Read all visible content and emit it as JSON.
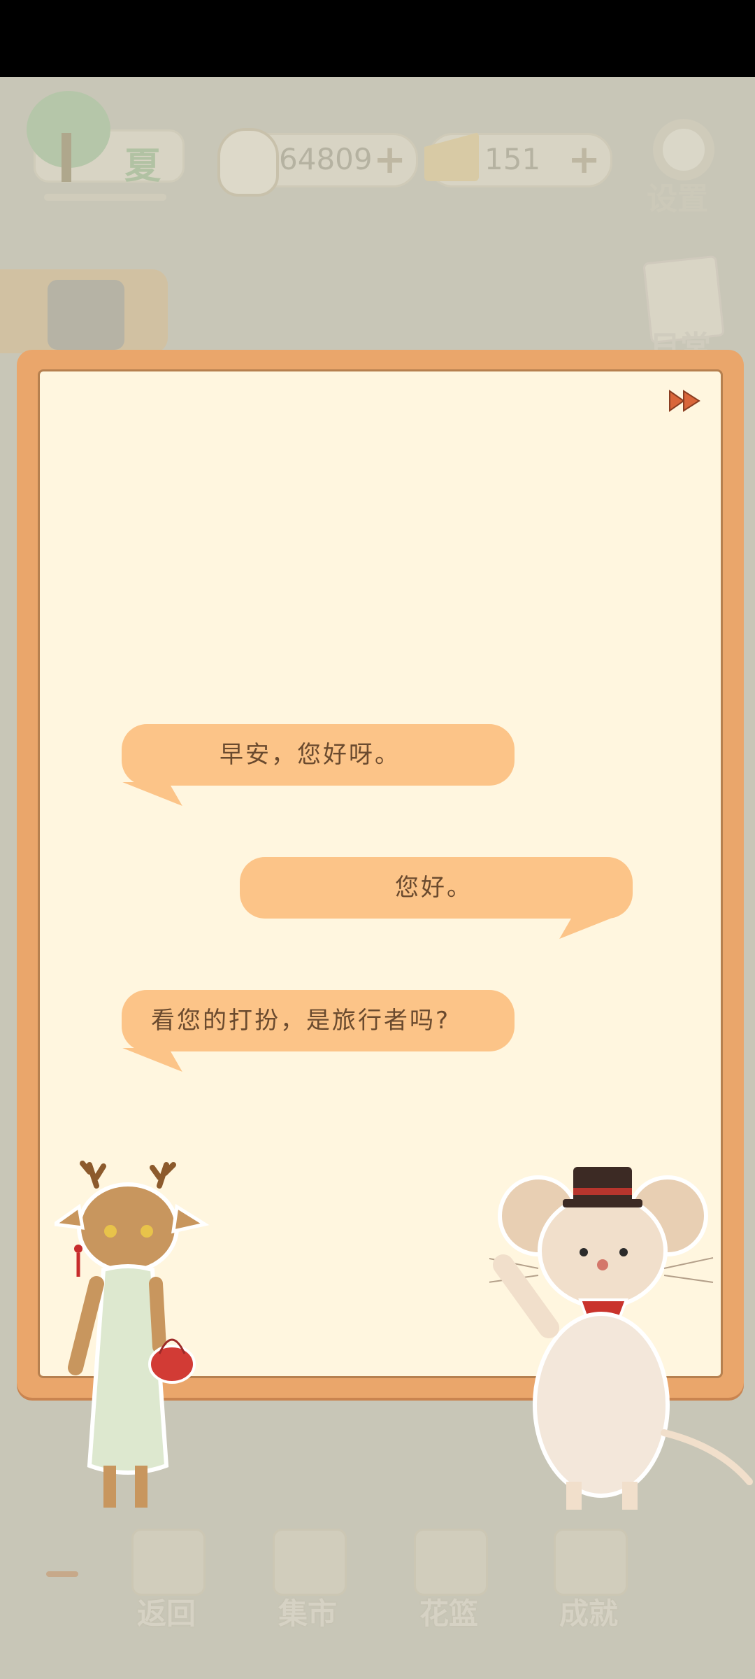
{
  "hud": {
    "season_label": "夏",
    "fish_count": "64809",
    "cheese_count": "151",
    "plus": "+",
    "settings_label": "设置",
    "daily_label": "日常"
  },
  "dialog": {
    "lines": [
      {
        "speaker": "left",
        "text": "早安，您好呀。"
      },
      {
        "speaker": "right",
        "text": "您好。"
      },
      {
        "speaker": "left",
        "text": "看您的打扮，是旅行者吗?"
      }
    ]
  },
  "nav": {
    "items": [
      {
        "label": "返回",
        "icon": "window-icon"
      },
      {
        "label": "集市",
        "icon": "market-stall-icon"
      },
      {
        "label": "花篮",
        "icon": "flower-basket-icon"
      },
      {
        "label": "成就",
        "icon": "trophy-icon"
      }
    ]
  },
  "colors": {
    "frame": "#eaa66b",
    "paper": "#fff6df",
    "bubble": "#fcc488",
    "bubble_text": "#6a4a2e",
    "skip_icon": "#d9663a"
  }
}
